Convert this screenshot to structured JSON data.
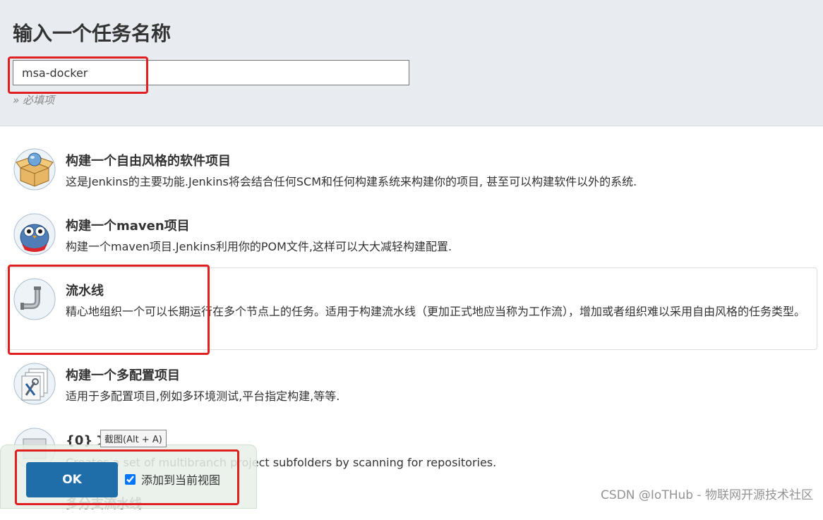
{
  "header": {
    "title": "输入一个任务名称",
    "name_input_value": "msa-docker",
    "required_note": "» 必填项"
  },
  "items": [
    {
      "title": "构建一个自由风格的软件项目",
      "description": "这是Jenkins的主要功能.Jenkins将会结合任何SCM和任何构建系统来构建你的项目, 甚至可以构建软件以外的系统.",
      "icon": "freestyle-box-icon"
    },
    {
      "title": "构建一个maven项目",
      "description": "构建一个maven项目.Jenkins利用你的POM文件,这样可以大大减轻构建配置.",
      "icon": "maven-owl-icon"
    },
    {
      "title": "流水线",
      "description": "精心地组织一个可以长期运行在多个节点上的任务。适用于构建流水线（更加正式地应当称为工作流），增加或者组织难以采用自由风格的任务类型。",
      "icon": "pipeline-icon"
    },
    {
      "title": "构建一个多配置项目",
      "description": "适用于多配置项目,例如多环境测试,平台指定构建,等等.",
      "icon": "multi-config-icon"
    },
    {
      "title": "{0} 文",
      "description": "Creates a set of multibranch project subfolders by scanning for repositories.",
      "icon": "folder-icon"
    },
    {
      "title": "多分支流水线",
      "description": "",
      "icon": "multibranch-pipeline-icon"
    }
  ],
  "tooltip": "截图(Alt + A)",
  "footer": {
    "ok_label": "OK",
    "add_to_view_label": "添加到当前视图",
    "add_to_view_checked": true
  },
  "watermark": "CSDN @IoTHub - 物联网开源技术社区"
}
